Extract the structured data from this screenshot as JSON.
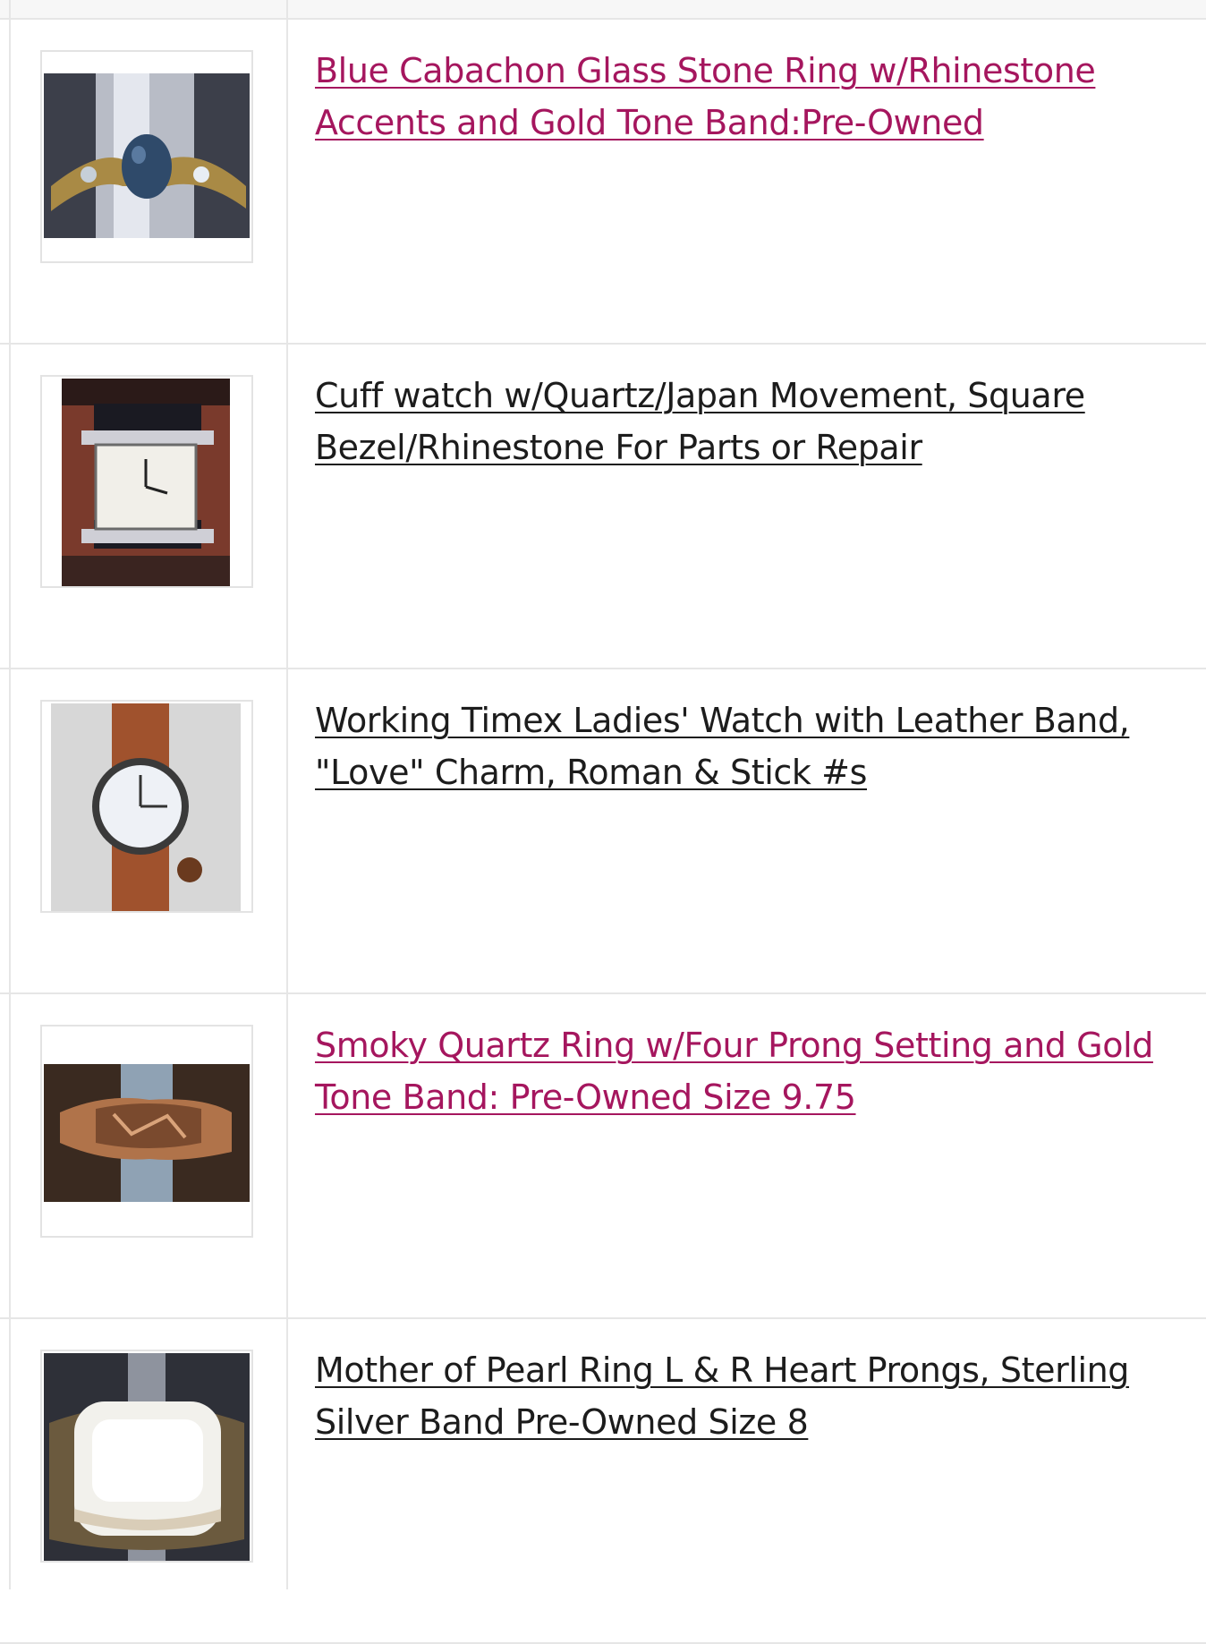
{
  "colors": {
    "visited_link": "#a5165e",
    "link": "#1c1c1c",
    "grid_line": "#e6e6e6"
  },
  "listings": [
    {
      "title": "Blue Cabachon Glass Stone Ring w/Rhinestone Accents and Gold Tone Band:Pre-Owned",
      "visited": true,
      "thumb_icon": "ring-blue-cabochon-photo"
    },
    {
      "title": "Cuff watch w/Quartz/Japan Movement, Square Bezel/Rhinestone For Parts or Repair",
      "visited": false,
      "thumb_icon": "cuff-watch-photo"
    },
    {
      "title": "Working Timex Ladies' Watch with Leather Band, \"Love\" Charm, Roman & Stick #s",
      "visited": false,
      "thumb_icon": "leather-watch-photo"
    },
    {
      "title": "Smoky Quartz Ring w/Four Prong Setting and Gold Tone Band: Pre-Owned Size 9.75",
      "visited": true,
      "thumb_icon": "smoky-quartz-ring-photo"
    },
    {
      "title": "Mother of Pearl Ring L & R Heart Prongs, Sterling Silver Band Pre-Owned Size 8",
      "visited": false,
      "thumb_icon": "mother-of-pearl-ring-photo"
    }
  ]
}
